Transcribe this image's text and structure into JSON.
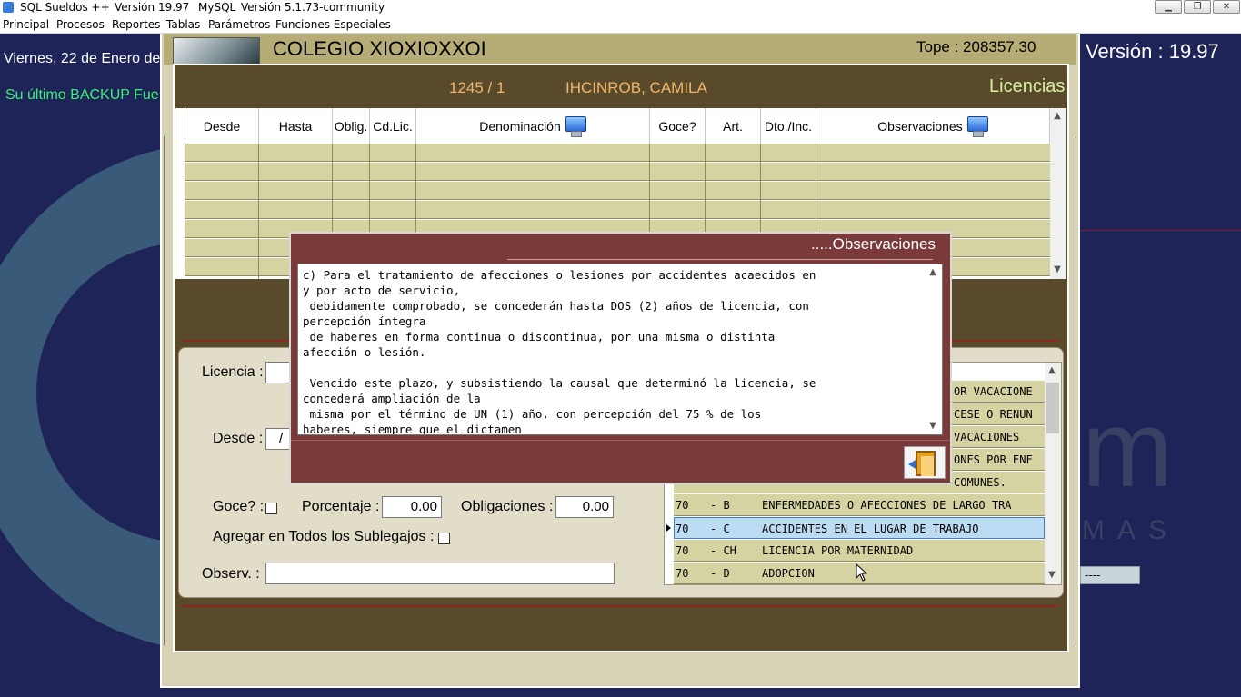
{
  "titlebar": {
    "app": "SQL Sueldos ++",
    "version": "Versión 19.97",
    "db": "MySQL",
    "db_version": "Versión 5.1.73-community"
  },
  "menu": [
    "Principal",
    "Procesos",
    "Reportes",
    "Tablas",
    "Parámetros",
    "Funciones Especiales"
  ],
  "desktop": {
    "date": "Viernes, 22 de Enero de",
    "backup": "Su último BACKUP Fue e",
    "version": "Versión : 19.97",
    "bg_text_1": "m",
    "bg_text_2": "MAS",
    "field_dashes": "----"
  },
  "main": {
    "school": "COLEGIO XIOXIOXXOI",
    "tope": "Tope : 208357.30"
  },
  "licencias": {
    "employee_number": "1245 / 1",
    "employee_name": "IHCINROB, CAMILA",
    "title": "Licencias",
    "columns": [
      "Desde",
      "Hasta",
      "Oblig.",
      "Cd.Lic.",
      "Denominación",
      "Goce?",
      "Art.",
      "Dto./Inc.",
      "Observaciones"
    ]
  },
  "form": {
    "licencia_label": "Licencia :",
    "desde_label": "Desde :",
    "desde_value": "/",
    "goce_label": "Goce? :",
    "porcentaje_label": "Porcentaje :",
    "porcentaje_value": "0.00",
    "obligaciones_label": "Obligaciones :",
    "obligaciones_value": "0.00",
    "agregar_label": "Agregar en Todos los Sublegajos :",
    "observ_label": "Observ. :"
  },
  "codes": [
    {
      "num": "",
      "code": "",
      "desc": "OR VACACIONE"
    },
    {
      "num": "",
      "code": "",
      "desc": "CESE O RENUN"
    },
    {
      "num": "",
      "code": "",
      "desc": "VACACIONES"
    },
    {
      "num": "",
      "code": "",
      "desc": "ONES POR ENF"
    },
    {
      "num": "",
      "code": "",
      "desc": "COMUNES."
    },
    {
      "num": "70",
      "code": "- B",
      "desc": "ENFERMEDADES O AFECCIONES DE LARGO TRA"
    },
    {
      "num": "70",
      "code": "- C",
      "desc": "ACCIDENTES EN EL LUGAR DE TRABAJO"
    },
    {
      "num": "70",
      "code": "- CH",
      "desc": "LICENCIA POR MATERNIDAD"
    },
    {
      "num": "70",
      "code": "- D",
      "desc": "ADOPCION"
    }
  ],
  "observaciones": {
    "title": ".....Observaciones",
    "text": "c) Para el tratamiento de afecciones o lesiones por accidentes acaecidos en\ny por acto de servicio,\n debidamente comprobado, se concederán hasta DOS (2) años de licencia, con\npercepción íntegra\n de haberes en forma continua o discontinua, por una misma o distinta\nafección o lesión.\n\n Vencido este plazo, y subsistiendo la causal que determinó la licencia, se\nconcederá ampliación de la\n misma por el término de UN (1) año, con percepción del 75 % de los\nhaberes, siempre que el dictamen"
  }
}
